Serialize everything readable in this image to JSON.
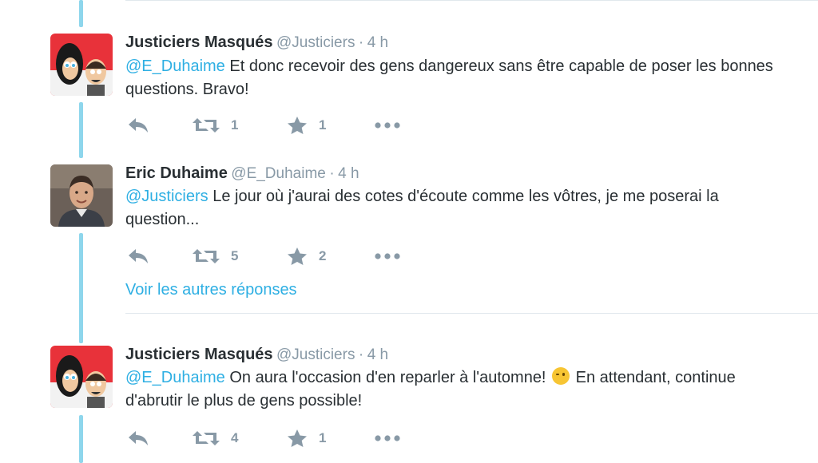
{
  "tweets": [
    {
      "name": "Justiciers Masqués",
      "handle": "@Justiciers",
      "dot": "·",
      "time": "4 h",
      "mention": "@E_Duhaime",
      "text": " Et donc recevoir des gens dangereux sans être capable de poser les bonnes questions. Bravo!",
      "retweets": "1",
      "likes": "1",
      "avatar": "cartoon-duo-avatar"
    },
    {
      "name": "Eric Duhaime",
      "handle": "@E_Duhaime",
      "dot": "·",
      "time": "4 h",
      "mention": "@Justiciers",
      "text": " Le jour où j'aurai des cotes d'écoute comme les vôtres, je me poserai la question...",
      "retweets": "5",
      "likes": "2",
      "avatar": "man-photo-avatar"
    },
    {
      "name": "Justiciers Masqués",
      "handle": "@Justiciers",
      "dot": "·",
      "time": "4 h",
      "mention": "@E_Duhaime",
      "text_before_emoji": " On aura l'occasion d'en reparler à l'automne! ",
      "emoji": "winking-face-emoji",
      "text_after_emoji": " En attendant, continue d'abrutir le plus de gens possible!",
      "retweets": "4",
      "likes": "1",
      "avatar": "cartoon-duo-avatar"
    }
  ],
  "more_replies_label": "Voir les autres réponses",
  "colors": {
    "mention": "#2eafe3",
    "thread_line": "#8ed6ec",
    "icon_gray": "#8899a6",
    "text": "#292f33",
    "avatar_red": "#e8323a"
  },
  "icons": [
    "reply-icon",
    "retweet-icon",
    "star-icon",
    "more-icon"
  ]
}
